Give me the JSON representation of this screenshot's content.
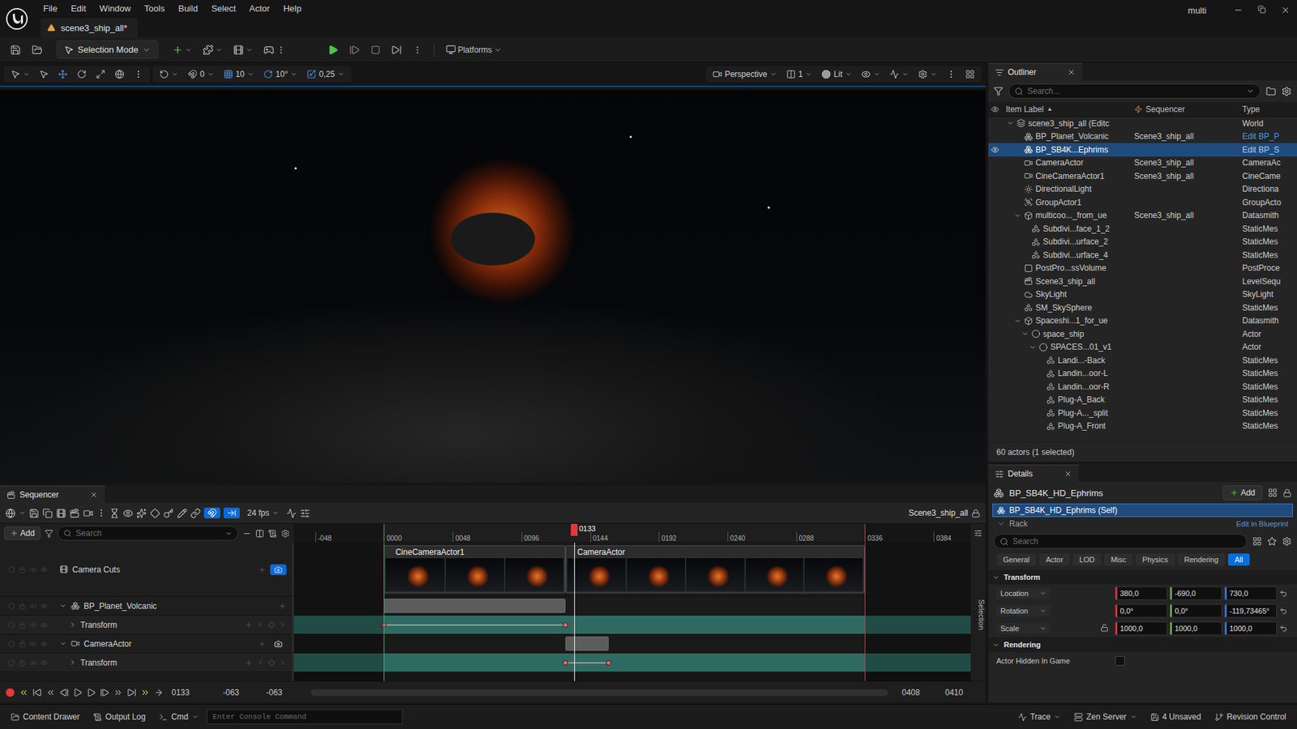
{
  "app": {
    "window_title": "multi",
    "document_tab": "scene3_ship_all*"
  },
  "menu": [
    "File",
    "Edit",
    "Window",
    "Tools",
    "Build",
    "Select",
    "Actor",
    "Help"
  ],
  "main_toolbar": {
    "mode": "Selection Mode",
    "platforms": "Platforms"
  },
  "viewport_toolbar": {
    "surface_snap": "0",
    "grid_snap": "10",
    "rotate_snap": "10°",
    "scale_snap": "0,25",
    "view": "Perspective",
    "layout": "1",
    "view_mode": "Lit"
  },
  "outliner": {
    "title": "Outliner",
    "search_placeholder": "Search...",
    "columns": {
      "label": "Item Label",
      "sort": "▲",
      "sequencer": "Sequencer",
      "type": "Type"
    },
    "rows": [
      {
        "label": "scene3_ship_all (Editc",
        "sequencer": "",
        "type": "World",
        "kind": "world",
        "depth": 0,
        "children": true,
        "expanded": true,
        "selected": false,
        "link": false
      },
      {
        "label": "BP_Planet_Volcanic",
        "sequencer": "Scene3_ship_all",
        "type": "Edit BP_P",
        "kind": "blueprint",
        "depth": 1,
        "children": false,
        "expanded": false,
        "selected": false,
        "link": true
      },
      {
        "label": "BP_SB4K...Ephrims",
        "sequencer": "",
        "type": "Edit BP_S",
        "kind": "blueprint",
        "depth": 1,
        "children": false,
        "expanded": false,
        "selected": true,
        "link": true
      },
      {
        "label": "CameraActor",
        "sequencer": "Scene3_ship_all",
        "type": "CameraAc",
        "kind": "camera",
        "depth": 1,
        "children": false,
        "expanded": false,
        "selected": false,
        "link": false
      },
      {
        "label": "CineCameraActor1",
        "sequencer": "Scene3_ship_all",
        "type": "CineCame",
        "kind": "camera",
        "depth": 1,
        "children": false,
        "expanded": false,
        "selected": false,
        "link": false
      },
      {
        "label": "DirectionalLight",
        "sequencer": "",
        "type": "Directiona",
        "kind": "light",
        "depth": 1,
        "children": false,
        "expanded": false,
        "selected": false,
        "link": false
      },
      {
        "label": "GroupActor1",
        "sequencer": "",
        "type": "GroupActo",
        "kind": "group",
        "depth": 1,
        "children": false,
        "expanded": false,
        "selected": false,
        "link": false
      },
      {
        "label": "multicoo..._from_ue",
        "sequencer": "Scene3_ship_all",
        "type": "Datasmith",
        "kind": "datasmith",
        "depth": 1,
        "children": true,
        "expanded": true,
        "selected": false,
        "link": false
      },
      {
        "label": "Subdivi...face_1_2",
        "sequencer": "",
        "type": "StaticMes",
        "kind": "mesh",
        "depth": 2,
        "children": false,
        "expanded": false,
        "selected": false,
        "link": false
      },
      {
        "label": "Subdivi...urface_2",
        "sequencer": "",
        "type": "StaticMes",
        "kind": "mesh",
        "depth": 2,
        "children": false,
        "expanded": false,
        "selected": false,
        "link": false
      },
      {
        "label": "Subdivi...urface_4",
        "sequencer": "",
        "type": "StaticMes",
        "kind": "mesh",
        "depth": 2,
        "children": false,
        "expanded": false,
        "selected": false,
        "link": false
      },
      {
        "label": "PostPro...ssVolume",
        "sequencer": "",
        "type": "PostProce",
        "kind": "volume",
        "depth": 1,
        "children": false,
        "expanded": false,
        "selected": false,
        "link": false
      },
      {
        "label": "Scene3_ship_all",
        "sequencer": "",
        "type": "LevelSequ",
        "kind": "sequence",
        "depth": 1,
        "children": false,
        "expanded": false,
        "selected": false,
        "link": false
      },
      {
        "label": "SkyLight",
        "sequencer": "",
        "type": "SkyLight",
        "kind": "skylight",
        "depth": 1,
        "children": false,
        "expanded": false,
        "selected": false,
        "link": false
      },
      {
        "label": "SM_SkySphere",
        "sequencer": "",
        "type": "StaticMes",
        "kind": "mesh",
        "depth": 1,
        "children": false,
        "expanded": false,
        "selected": false,
        "link": false
      },
      {
        "label": "Spaceshi...1_for_ue",
        "sequencer": "",
        "type": "Datasmith",
        "kind": "datasmith",
        "depth": 1,
        "children": true,
        "expanded": true,
        "selected": false,
        "link": false
      },
      {
        "label": "space_ship",
        "sequencer": "",
        "type": "Actor",
        "kind": "actor",
        "depth": 2,
        "children": true,
        "expanded": true,
        "selected": false,
        "link": false
      },
      {
        "label": "SPACES...01_v1",
        "sequencer": "",
        "type": "Actor",
        "kind": "actor",
        "depth": 3,
        "children": true,
        "expanded": true,
        "selected": false,
        "link": false
      },
      {
        "label": "Landi...-Back",
        "sequencer": "",
        "type": "StaticMes",
        "kind": "mesh",
        "depth": 4,
        "children": false,
        "expanded": false,
        "selected": false,
        "link": false
      },
      {
        "label": "Landin...oor-L",
        "sequencer": "",
        "type": "StaticMes",
        "kind": "mesh",
        "depth": 4,
        "children": false,
        "expanded": false,
        "selected": false,
        "link": false
      },
      {
        "label": "Landin...oor-R",
        "sequencer": "",
        "type": "StaticMes",
        "kind": "mesh",
        "depth": 4,
        "children": false,
        "expanded": false,
        "selected": false,
        "link": false
      },
      {
        "label": "Plug-A_Back",
        "sequencer": "",
        "type": "StaticMes",
        "kind": "mesh",
        "depth": 4,
        "children": false,
        "expanded": false,
        "selected": false,
        "link": false
      },
      {
        "label": "Plug-A..._split",
        "sequencer": "",
        "type": "StaticMes",
        "kind": "mesh",
        "depth": 4,
        "children": false,
        "expanded": false,
        "selected": false,
        "link": false
      },
      {
        "label": "Plug-A_Front",
        "sequencer": "",
        "type": "StaticMes",
        "kind": "mesh",
        "depth": 4,
        "children": false,
        "expanded": false,
        "selected": false,
        "link": false
      }
    ],
    "count": "60 actors (1 selected)"
  },
  "details": {
    "title": "Details",
    "actor": "BP_SB4K_HD_Ephrims",
    "add": "Add",
    "components": [
      {
        "label": "BP_SB4K_HD_Ephrims (Self)",
        "selected": true
      },
      {
        "label": "Rack",
        "selected": false
      }
    ],
    "edit_link": "Edit in Blueprint",
    "search_placeholder": "Search",
    "filters": [
      {
        "label": "General",
        "selected": false
      },
      {
        "label": "Actor",
        "selected": false
      },
      {
        "label": "LOD",
        "selected": false
      },
      {
        "label": "Misc",
        "selected": false
      },
      {
        "label": "Physics",
        "selected": false
      },
      {
        "label": "Rendering",
        "selected": false
      },
      {
        "label": "All",
        "selected": true
      }
    ],
    "sections": [
      {
        "title": "Transform",
        "expanded": true,
        "properties": [
          {
            "name": "Location",
            "kind": "vector",
            "values": [
              "380,0",
              "-690,0",
              "730,0"
            ],
            "locked": false
          },
          {
            "name": "Rotation",
            "kind": "vector",
            "values": [
              "0,0°",
              "0,0°",
              "-119,73465°"
            ],
            "locked": false
          },
          {
            "name": "Scale",
            "kind": "vector",
            "values": [
              "1000,0",
              "1000,0",
              "1000,0"
            ],
            "locked": false
          }
        ]
      },
      {
        "title": "Rendering",
        "expanded": true,
        "properties": [
          {
            "name": "Actor Hidden In Game",
            "kind": "checkbox",
            "checked": false
          }
        ]
      }
    ]
  },
  "sequencer": {
    "title": "Sequencer",
    "fps": "24 fps",
    "sequence": "Scene3_ship_all",
    "add": "Add",
    "search_placeholder": "Search",
    "selection_label": "Selection",
    "view_range": {
      "start": -63,
      "end": 410
    },
    "playback_range": {
      "start": 0,
      "end": 336
    },
    "playhead": {
      "label": "0133",
      "frame": 133
    },
    "ruler": [
      {
        "label": "-048",
        "frame": -48
      },
      {
        "label": "0000",
        "frame": 0
      },
      {
        "label": "0048",
        "frame": 48
      },
      {
        "label": "0096",
        "frame": 96
      },
      {
        "label": "0144",
        "frame": 144
      },
      {
        "label": "0192",
        "frame": 192
      },
      {
        "label": "0240",
        "frame": 240
      },
      {
        "label": "0288",
        "frame": 288
      },
      {
        "label": "0336",
        "frame": 336
      },
      {
        "label": "0384",
        "frame": 384
      }
    ],
    "tracks": [
      {
        "name": "Camera Cuts",
        "kind": "cuts",
        "depth": 0,
        "children": false,
        "expanded": false,
        "locked": true,
        "clips": [
          {
            "label": "CineCameraActor1",
            "start": 0,
            "end": 127
          },
          {
            "label": "CameraActor",
            "start": 127,
            "end": 336
          }
        ]
      },
      {
        "name": "BP_Planet_Volcanic",
        "kind": "object",
        "depth": 0,
        "children": true,
        "expanded": true,
        "bar": {
          "start": 0,
          "end": 127
        }
      },
      {
        "name": "Transform",
        "kind": "property",
        "depth": 1,
        "children": true,
        "expanded": false,
        "keys": [
          0,
          127
        ]
      },
      {
        "name": "CameraActor",
        "kind": "camera",
        "depth": 0,
        "children": true,
        "expanded": true,
        "bar": {
          "start": 127,
          "end": 157
        }
      },
      {
        "name": "Transform",
        "kind": "property",
        "depth": 1,
        "children": true,
        "expanded": false,
        "keys": [
          127,
          157
        ]
      }
    ],
    "transport": {
      "current": "0133",
      "view_start": "-063",
      "playback_start": "-063",
      "playback_end": "0408",
      "view_end": "0410"
    }
  },
  "status_bar": {
    "left": [
      "Content Drawer",
      "Output Log",
      "Cmd"
    ],
    "console_placeholder": "Enter Console Command",
    "right": [
      "Trace",
      "Zen Server",
      "4 Unsaved",
      "Revision Control"
    ]
  }
}
